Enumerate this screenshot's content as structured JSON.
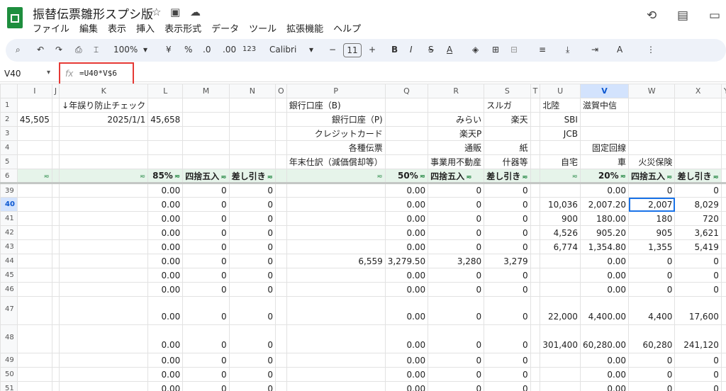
{
  "doc": {
    "title": "振替伝票雛形スプシ版",
    "star_icon": "star-icon",
    "folder_icon": "move-folder-icon",
    "cloud_icon": "cloud-status-icon"
  },
  "menu": [
    "ファイル",
    "編集",
    "表示",
    "挿入",
    "表示形式",
    "データ",
    "ツール",
    "拡張機能",
    "ヘルプ"
  ],
  "toolbar": {
    "zoom": "100%",
    "currency": "¥",
    "percent": "%",
    "dec_minus": ".0",
    "dec_plus": ".00",
    "more_formats": "123",
    "font": "Calibri",
    "font_size": "11",
    "minus": "−",
    "plus": "+",
    "bold": "B",
    "italic": "I",
    "strike": "S",
    "text_color": "A"
  },
  "formula_bar": {
    "cell_ref": "V40",
    "fx": "fx",
    "formula": "=U40*V$6"
  },
  "columns": [
    "",
    "I",
    "J",
    "K",
    "L",
    "M",
    "N",
    "O",
    "P",
    "Q",
    "R",
    "S",
    "T",
    "U",
    "V",
    "W",
    "X",
    "Y"
  ],
  "rows": [
    {
      "n": "1",
      "c": [
        "",
        "",
        "↓年誤り防止チェック",
        "",
        "",
        "",
        "",
        "銀行口座（B)",
        "",
        "",
        "スルガ",
        "",
        "北陸",
        "滋賀中信",
        "",
        ""
      ]
    },
    {
      "n": "2",
      "c": [
        "45,505",
        "",
        "2025/1/1",
        "45,658",
        "",
        "",
        "",
        "銀行口座（P)",
        "",
        "みらい",
        "楽天",
        "",
        "SBI",
        "",
        "",
        ""
      ]
    },
    {
      "n": "3",
      "c": [
        "",
        "",
        "",
        "",
        "",
        "",
        "",
        "クレジットカード",
        "",
        "楽天P",
        "",
        "",
        "JCB",
        "",
        "",
        ""
      ]
    },
    {
      "n": "4",
      "c": [
        "",
        "",
        "",
        "",
        "",
        "",
        "",
        "各種伝票",
        "",
        "通販",
        "紙",
        "",
        "",
        "固定回線",
        "",
        ""
      ]
    },
    {
      "n": "5",
      "c": [
        "",
        "",
        "",
        "",
        "",
        "",
        "",
        "年末仕訳（減価償却等）",
        "",
        "事業用不動産",
        "什器等",
        "",
        "自宅",
        "車",
        "火災保険",
        ""
      ]
    },
    {
      "n": "6",
      "c": [
        "",
        "",
        "",
        "85%",
        "四捨五入",
        "差し引き",
        "",
        "",
        "50%",
        "四捨五入",
        "差し引き",
        "",
        "",
        "20%",
        "四捨五入",
        "差し引き"
      ]
    },
    {
      "n": "39",
      "c": [
        "",
        "",
        "",
        "0.00",
        "0",
        "0",
        "",
        "",
        "0.00",
        "0",
        "0",
        "",
        "",
        "0.00",
        "0",
        "0"
      ]
    },
    {
      "n": "40",
      "c": [
        "",
        "",
        "",
        "0.00",
        "0",
        "0",
        "",
        "",
        "0.00",
        "0",
        "0",
        "",
        "10,036",
        "2,007.20",
        "2,007",
        "8,029"
      ]
    },
    {
      "n": "41",
      "c": [
        "",
        "",
        "",
        "0.00",
        "0",
        "0",
        "",
        "",
        "0.00",
        "0",
        "0",
        "",
        "900",
        "180.00",
        "180",
        "720"
      ]
    },
    {
      "n": "42",
      "c": [
        "",
        "",
        "",
        "0.00",
        "0",
        "0",
        "",
        "",
        "0.00",
        "0",
        "0",
        "",
        "4,526",
        "905.20",
        "905",
        "3,621"
      ]
    },
    {
      "n": "43",
      "c": [
        "",
        "",
        "",
        "0.00",
        "0",
        "0",
        "",
        "",
        "0.00",
        "0",
        "0",
        "",
        "6,774",
        "1,354.80",
        "1,355",
        "5,419"
      ]
    },
    {
      "n": "44",
      "c": [
        "",
        "",
        "",
        "0.00",
        "0",
        "0",
        "",
        "6,559",
        "3,279.50",
        "3,280",
        "3,279",
        "",
        "",
        "0.00",
        "0",
        "0"
      ]
    },
    {
      "n": "45",
      "c": [
        "",
        "",
        "",
        "0.00",
        "0",
        "0",
        "",
        "",
        "0.00",
        "0",
        "0",
        "",
        "",
        "0.00",
        "0",
        "0"
      ]
    },
    {
      "n": "46",
      "c": [
        "",
        "",
        "",
        "0.00",
        "0",
        "0",
        "",
        "",
        "0.00",
        "0",
        "0",
        "",
        "",
        "0.00",
        "0",
        "0"
      ]
    },
    {
      "n": "47",
      "c": [
        "",
        "",
        "",
        "0.00",
        "0",
        "0",
        "",
        "",
        "0.00",
        "0",
        "0",
        "",
        "22,000",
        "4,400.00",
        "4,400",
        "17,600"
      ]
    },
    {
      "n": "48",
      "c": [
        "",
        "",
        "",
        "0.00",
        "0",
        "0",
        "",
        "",
        "0.00",
        "0",
        "0",
        "",
        "301,400",
        "60,280.00",
        "60,280",
        "241,120"
      ]
    },
    {
      "n": "49",
      "c": [
        "",
        "",
        "",
        "0.00",
        "0",
        "0",
        "",
        "",
        "0.00",
        "0",
        "0",
        "",
        "",
        "0.00",
        "0",
        "0"
      ]
    },
    {
      "n": "50",
      "c": [
        "",
        "",
        "",
        "0.00",
        "0",
        "0",
        "",
        "",
        "0.00",
        "0",
        "0",
        "",
        "",
        "0.00",
        "0",
        "0"
      ]
    },
    {
      "n": "51",
      "c": [
        "",
        "",
        "",
        "0.00",
        "0",
        "0",
        "",
        "",
        "0.00",
        "0",
        "0",
        "",
        "",
        "0.00",
        "0",
        "0"
      ]
    }
  ],
  "accent": "#1a73e8",
  "header_green": "#e6f4ea",
  "highlight_red": "#e53935"
}
